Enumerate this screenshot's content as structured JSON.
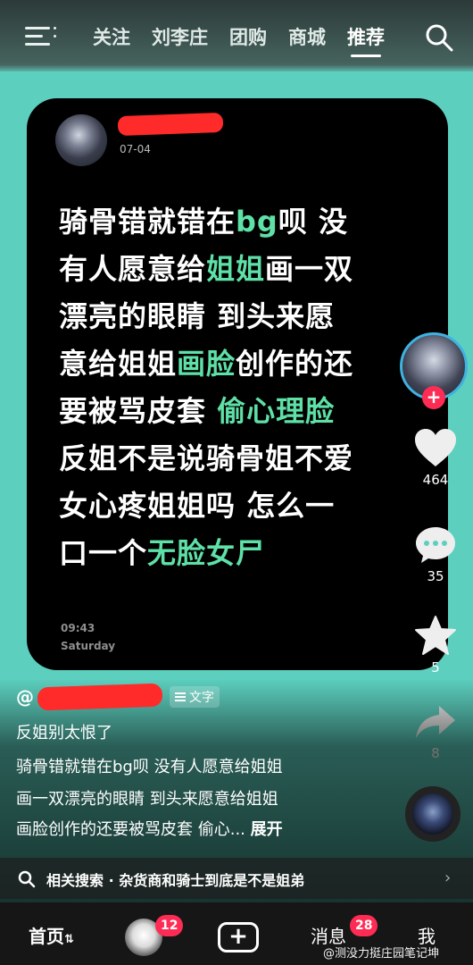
{
  "top_nav": {
    "tabs": [
      {
        "label": "关注"
      },
      {
        "label": "刘李庄"
      },
      {
        "label": "团购"
      },
      {
        "label": "商城"
      },
      {
        "label": "推荐"
      }
    ]
  },
  "post": {
    "date": "07-04",
    "body": [
      [
        {
          "t": "骑骨错就错在"
        },
        {
          "t": "bg",
          "hl": true
        },
        {
          "t": "呗 没"
        }
      ],
      [
        {
          "t": "有人愿意给"
        },
        {
          "t": "姐姐",
          "hl": true
        },
        {
          "t": "画一双"
        }
      ],
      [
        {
          "t": "漂亮的眼睛 到头来愿"
        }
      ],
      [
        {
          "t": "意给姐姐"
        },
        {
          "t": "画脸",
          "hl": true
        },
        {
          "t": "创作的还"
        }
      ],
      [
        {
          "t": "要被骂皮套 "
        },
        {
          "t": "偷心理脸",
          "hl": true
        }
      ],
      [
        {
          "t": "反姐不是说骑骨姐不爱"
        }
      ],
      [
        {
          "t": "女心疼姐姐吗 怎么一"
        }
      ],
      [
        {
          "t": "口一个"
        },
        {
          "t": "无脸女尸",
          "hl": true
        }
      ]
    ],
    "time": "09:43",
    "day": "Saturday",
    "highlight_color": "#5ee0a7"
  },
  "actions": {
    "likes": "464",
    "comments": "35",
    "favorites": "5",
    "shares": "8"
  },
  "caption": {
    "at": "@",
    "tag": "文字",
    "title": "反姐别太恨了",
    "lines": [
      "骑骨错就错在bg呗 没有人愿意给姐姐",
      "画一双漂亮的眼睛 到头来愿意给姐姐",
      "画脸创作的还要被骂皮套 偷心..."
    ],
    "expand": "展开"
  },
  "related": {
    "text": "相关搜索 · 杂货商和骑士到底是不是姐弟"
  },
  "bottom_nav": {
    "home": "首页",
    "friends_badge": "12",
    "messages": "消息",
    "messages_badge": "28",
    "me": "我"
  },
  "watermark": "@测没力挺庄园笔记坤",
  "colors": {
    "accent": "#fe2c55",
    "background": "#5ccfbe"
  }
}
